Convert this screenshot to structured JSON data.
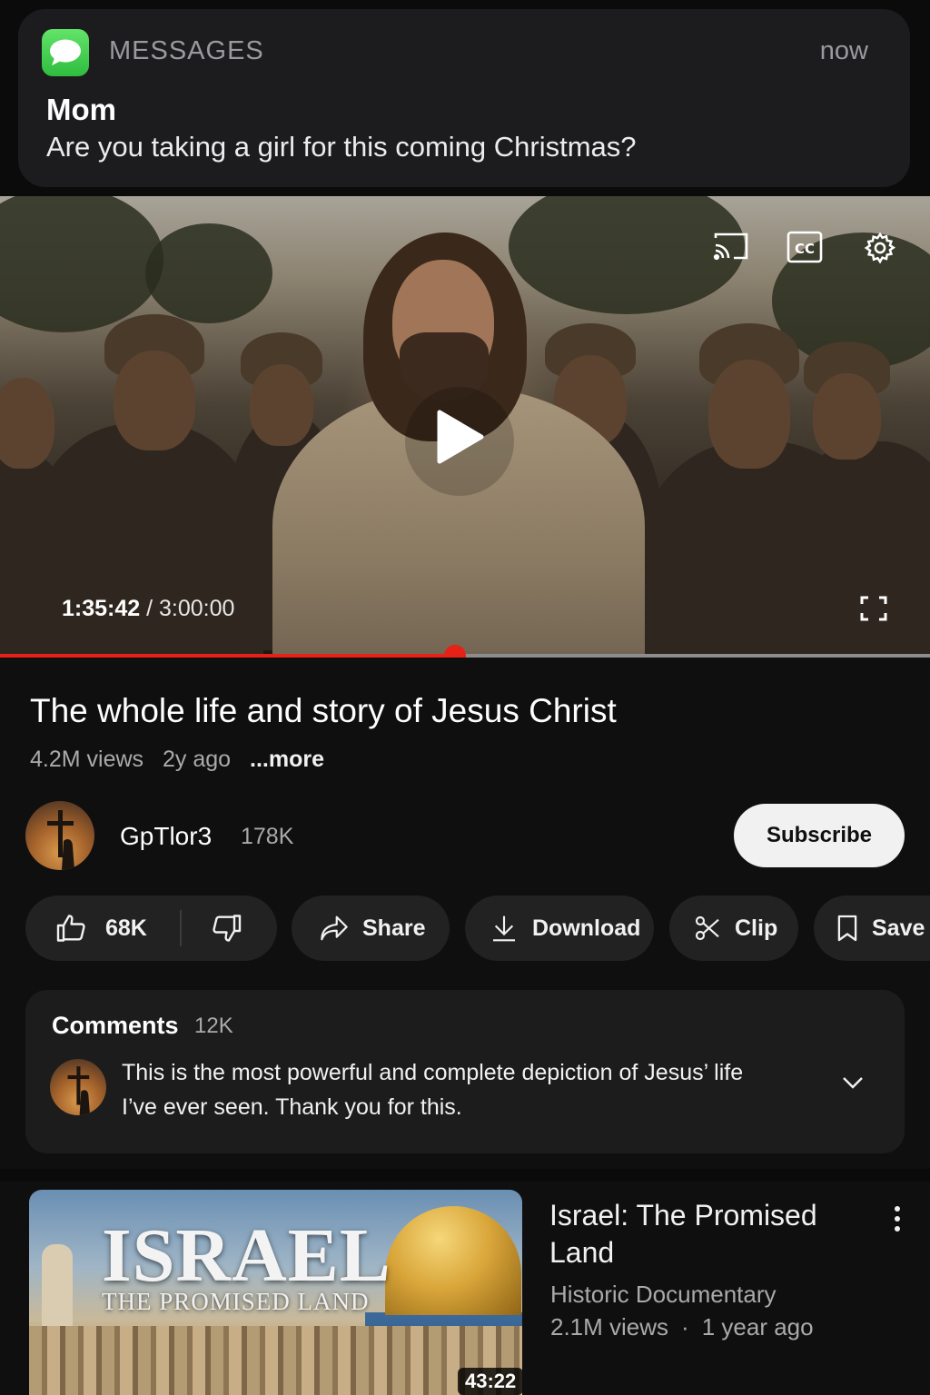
{
  "notification": {
    "app_name": "MESSAGES",
    "time": "now",
    "sender": "Mom",
    "message": "Are you taking a girl for this coming Christmas?"
  },
  "player": {
    "current_time": "1:35:42",
    "separator": " / ",
    "total_time": "3:00:00",
    "progress_fraction": 0.489,
    "icons": [
      "cast-icon",
      "cc-icon",
      "gear-icon",
      "play-icon",
      "fullscreen-icon"
    ],
    "accent_color": "#e62117"
  },
  "video": {
    "title": "The whole life and story of Jesus Christ",
    "views": "4.2M views",
    "age": "2y ago",
    "more": "...more"
  },
  "channel": {
    "name": "GpTlor3",
    "subscribers": "178K",
    "subscribe_label": "Subscribe"
  },
  "actions": {
    "likes": "68K",
    "share": "Share",
    "download": "Download",
    "clip": "Clip",
    "save": "Save"
  },
  "comments": {
    "title": "Comments",
    "count": "12K",
    "top_comment": "This is the most powerful and complete depiction of Jesus’ life I’ve ever seen. Thank you for this."
  },
  "recommended": {
    "thumb_title": "ISRAEL",
    "thumb_subtitle": "THE PROMISED LAND",
    "duration": "43:22",
    "title": "Israel: The Promised Land",
    "channel": "Historic Documentary",
    "views": "2.1M views",
    "dot": "·",
    "age": "1 year ago"
  }
}
